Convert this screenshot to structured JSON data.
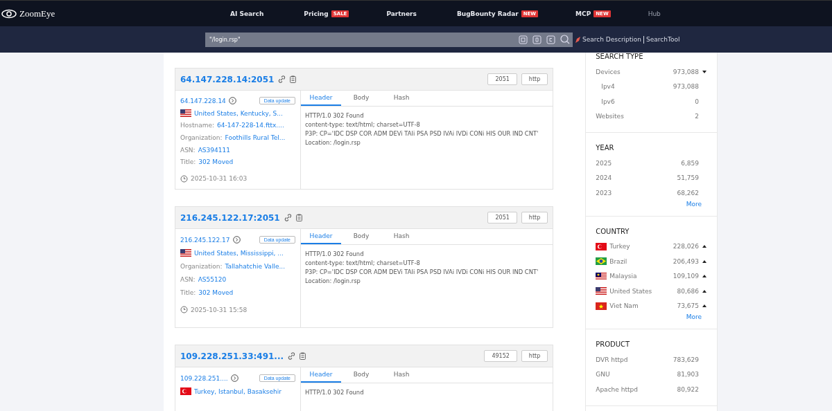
{
  "brand": {
    "name": "ZoomEye"
  },
  "nav": [
    {
      "label": "AI Search",
      "muted": false
    },
    {
      "label": "Pricing",
      "badge": "SALE",
      "muted": false
    },
    {
      "label": "Partners",
      "muted": false
    },
    {
      "label": "BugBounty Radar",
      "badge": "NEW",
      "muted": false
    },
    {
      "label": "MCP",
      "badge": "NEW",
      "muted": false
    },
    {
      "label": "Hub",
      "muted": true
    }
  ],
  "search": {
    "value": "\"/login.rsp\"",
    "links": [
      "Search Description",
      "SearchTool"
    ]
  },
  "results": [
    {
      "address": "64.147.228.14:2051",
      "port": "2051",
      "protocol": "http",
      "ip": "64.147.228.14",
      "update": "Data update",
      "kind": "us",
      "location": "United States, Kentucky, S...",
      "fields": [
        {
          "label": "Hostname:",
          "value": "64-147-228-14.fttx...."
        },
        {
          "label": "Organization:",
          "value": "Foothills Rural Tel..."
        },
        {
          "label": "ASN:",
          "value": "AS394111"
        },
        {
          "label": "Title:",
          "value": "302 Moved"
        }
      ],
      "time": "2025-10-31 16:03",
      "tabs": [
        {
          "label": "Header",
          "selected": true
        },
        {
          "label": "Body",
          "selected": false
        },
        {
          "label": "Hash",
          "selected": false
        }
      ],
      "lines": [
        "HTTP/1.0 302 Found",
        "content-type: text/html; charset=UTF-8",
        "P3P: CP='IDC DSP COR ADM DEVi TAIi PSA PSD IVAi IVDi CONi HIS OUR IND CNT'",
        "Location: /login.rsp"
      ]
    },
    {
      "address": "216.245.122.17:2051",
      "port": "2051",
      "protocol": "http",
      "ip": "216.245.122.17",
      "update": "Data update",
      "kind": "us",
      "location": "United States, Mississippi, ...",
      "fields": [
        {
          "label": "Organization:",
          "value": "Tallahatchie Valle..."
        },
        {
          "label": "ASN:",
          "value": "AS55120"
        },
        {
          "label": "Title:",
          "value": "302 Moved"
        }
      ],
      "time": "2025-10-31 15:58",
      "tabs": [
        {
          "label": "Header",
          "selected": true
        },
        {
          "label": "Body",
          "selected": false
        },
        {
          "label": "Hash",
          "selected": false
        }
      ],
      "lines": [
        "HTTP/1.0 302 Found",
        "content-type: text/html; charset=UTF-8",
        "P3P: CP='IDC DSP COR ADM DEVi TAIi PSA PSD IVAi IVDi CONi HIS OUR IND CNT'",
        "Location: /login.rsp"
      ]
    },
    {
      "address": "109.228.251.33:491...",
      "port": "49152",
      "protocol": "http",
      "ip": "109.228.251....",
      "update": "Data update",
      "kind": "tr",
      "location": "Turkey, Istanbul, Basaksehir",
      "tabs": [
        {
          "label": "Header",
          "selected": true
        },
        {
          "label": "Body",
          "selected": false
        },
        {
          "label": "Hash",
          "selected": false
        }
      ],
      "lines": [
        "HTTP/1.0 302 Found"
      ]
    }
  ],
  "facets": [
    {
      "title": "SEARCH TYPE",
      "rows": [
        {
          "label": "Devices",
          "count": "973,088",
          "expanded": true,
          "indent": false
        },
        {
          "label": "Ipv4",
          "count": "973,088",
          "indent": true
        },
        {
          "label": "Ipv6",
          "count": "0",
          "indent": true
        },
        {
          "label": "Websites",
          "count": "2",
          "indent": false
        }
      ]
    },
    {
      "title": "YEAR",
      "rows": [
        {
          "label": "2025",
          "count": "6,859"
        },
        {
          "label": "2024",
          "count": "51,759"
        },
        {
          "label": "2023",
          "count": "68,262"
        }
      ],
      "more": "More"
    },
    {
      "title": "COUNTRY",
      "rows": [
        {
          "label": "Turkey",
          "count": "228,026",
          "kind": "tr",
          "expanded": false
        },
        {
          "label": "Brazil",
          "count": "206,493",
          "kind": "br",
          "expanded": false
        },
        {
          "label": "Malaysia",
          "count": "109,109",
          "kind": "my",
          "expanded": false
        },
        {
          "label": "United States",
          "count": "80,686",
          "kind": "us",
          "expanded": false
        },
        {
          "label": "Viet Nam",
          "count": "73,675",
          "kind": "vn",
          "expanded": false
        }
      ],
      "more": "More"
    },
    {
      "title": "PRODUCT",
      "rows": [
        {
          "label": "DVR httpd",
          "count": "783,629"
        },
        {
          "label": "GNU",
          "count": "81,903"
        },
        {
          "label": "Apache httpd",
          "count": "80,922"
        }
      ]
    }
  ]
}
